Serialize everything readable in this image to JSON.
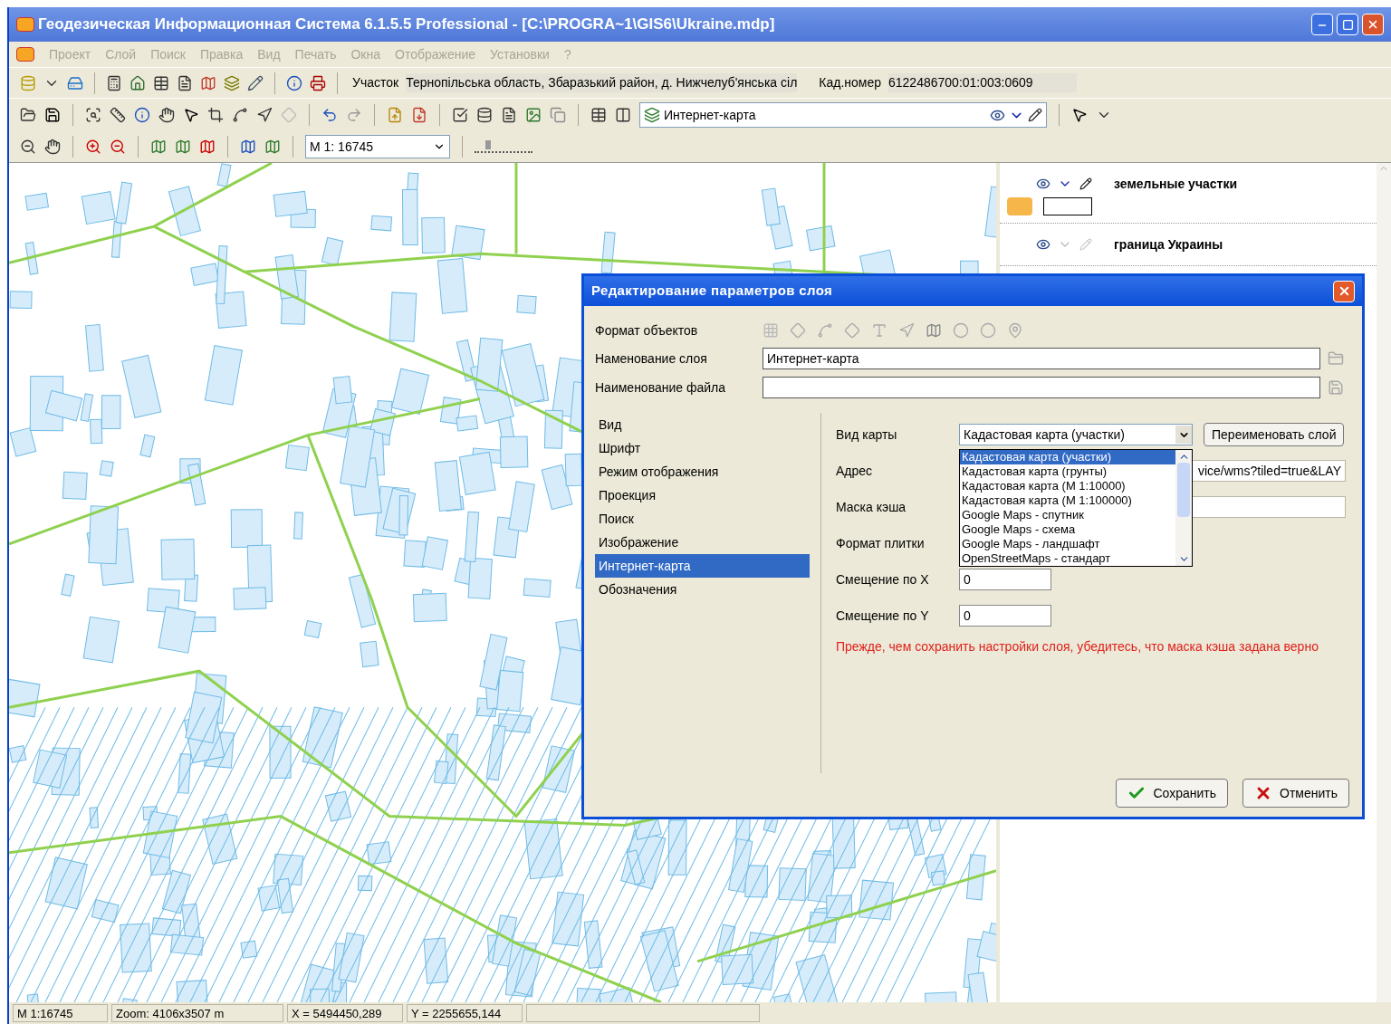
{
  "window": {
    "title": "Геодезическая Информационная Система 6.1.5.5 Professional - [C:\\PROGRA~1\\GIS6\\Ukraine.mdp]"
  },
  "menu": [
    {
      "label": "Проект",
      "disabled": true
    },
    {
      "label": "Слой",
      "disabled": true
    },
    {
      "label": "Поиск",
      "disabled": true
    },
    {
      "label": "Правка",
      "disabled": true
    },
    {
      "label": "Вид",
      "disabled": true
    },
    {
      "label": "Печать",
      "disabled": true
    },
    {
      "label": "Окна",
      "disabled": true
    },
    {
      "label": "Отображение",
      "disabled": true
    },
    {
      "label": "Установки",
      "disabled": true
    },
    {
      "label": "?",
      "disabled": true
    }
  ],
  "info_bar": {
    "parcel_label": "Участок",
    "parcel_value": "Тернопільська область, Збаразький район, д. Нижчелуб'янська сіл",
    "cad_label": "Кад.номер",
    "cad_value": "6122486700:01:003:0609"
  },
  "layer_selector": {
    "value": "Интернет-карта"
  },
  "scale_combo": {
    "value": "М 1: 16745"
  },
  "scale_slider": {
    "level": 0.2
  },
  "layers": [
    {
      "name": "земельные участки",
      "editable": true
    },
    {
      "name": "граница Украины",
      "editable": false
    }
  ],
  "dialog": {
    "title": "Редактирование параметров слоя",
    "format_label": "Формат объектов",
    "layer_name_label": "Наменование слоя",
    "layer_name_value": "Интернет-карта",
    "file_name_label": "Наименование файла",
    "sections": [
      {
        "label": "Вид",
        "selected": false
      },
      {
        "label": "Шрифт",
        "selected": false
      },
      {
        "label": "Режим отображения",
        "selected": false
      },
      {
        "label": "Проекция",
        "selected": false
      },
      {
        "label": "Поиск",
        "selected": false
      },
      {
        "label": "Изображение",
        "selected": false
      },
      {
        "label": "Интернет-карта",
        "selected": true
      },
      {
        "label": "Обозначения",
        "selected": false
      }
    ],
    "map_type_label": "Вид карты",
    "map_type_value": "Кадастовая карта (участки)",
    "rename_button": "Переименовать слой",
    "map_type_options": [
      {
        "label": "Кадастовая карта (участки)",
        "selected": true
      },
      {
        "label": "Кадастовая карта (грунты)",
        "selected": false
      },
      {
        "label": "Кадастовая карта (М 1:10000)",
        "selected": false
      },
      {
        "label": "Кадастовая карта (М 1:100000)",
        "selected": false
      },
      {
        "label": "Google Maps - спутник",
        "selected": false
      },
      {
        "label": "Google Maps - схема",
        "selected": false
      },
      {
        "label": "Google Maps - ландшафт",
        "selected": false
      },
      {
        "label": "OpenStreetMaps - стандарт",
        "selected": false
      }
    ],
    "address_label": "Адрес",
    "address_value": "vice/wms?tiled=true&LAY",
    "cache_mask_label": "Маска кэша",
    "tile_format_label": "Формат плитки",
    "offset_x_label": "Смещение по X",
    "offset_x_value": "0",
    "offset_y_label": "Смещение по Y",
    "offset_y_value": "0",
    "warning": "Прежде, чем сохранить настройки слоя, убедитесь, что маска кэша задана верно",
    "save_button": "Сохранить",
    "cancel_button": "Отменить"
  },
  "status_bar": [
    "М 1:16745",
    "Zoom: 4106x3507 m",
    "X = 5494450,289",
    "Y = 2255655,144"
  ]
}
